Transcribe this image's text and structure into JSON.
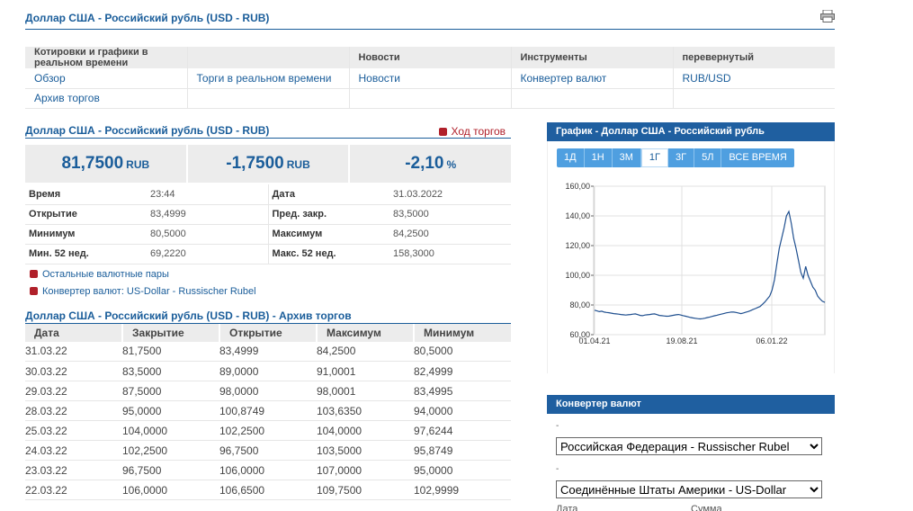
{
  "page_title": "Доллар США - Российский рубль (USD - RUB)",
  "nav": {
    "headers": [
      "Котировки и графики в реальном времени",
      "",
      "Новости",
      "Инструменты",
      "перевернутый"
    ],
    "row1": [
      "Обзор",
      "Торги в реальном времени",
      "Новости",
      "Конвертер валют",
      "RUB/USD"
    ],
    "row2": [
      "Архив торгов",
      "",
      "",
      "",
      ""
    ]
  },
  "quote": {
    "title": "Доллар США - Российский рубль (USD - RUB)",
    "live_link": "Ход торгов",
    "price": "81,7500",
    "price_unit": "RUB",
    "change": "-1,7500",
    "change_unit": "RUB",
    "change_pct": "-2,10",
    "pct_unit": "%"
  },
  "stats": [
    {
      "l1": "Время",
      "v1": "23:44",
      "l2": "Дата",
      "v2": "31.03.2022"
    },
    {
      "l1": "Открытие",
      "v1": "83,4999",
      "l2": "Пред. закр.",
      "v2": "83,5000"
    },
    {
      "l1": "Минимум",
      "v1": "80,5000",
      "l2": "Максимум",
      "v2": "84,2500"
    },
    {
      "l1": "Мин. 52 нед.",
      "v1": "69,2220",
      "l2": "Макс. 52 нед.",
      "v2": "158,3000"
    }
  ],
  "links": [
    "Остальные валютные пары",
    "Конвертер валют: US-Dollar - Russischer Rubel"
  ],
  "archive": {
    "title": "Доллар США - Российский рубль (USD - RUB) - Архив торгов",
    "headers": [
      "Дата",
      "Закрытие",
      "Открытие",
      "Максимум",
      "Минимум"
    ],
    "rows": [
      [
        "31.03.22",
        "81,7500",
        "83,4999",
        "84,2500",
        "80,5000"
      ],
      [
        "30.03.22",
        "83,5000",
        "89,0000",
        "91,0001",
        "82,4999"
      ],
      [
        "29.03.22",
        "87,5000",
        "98,0000",
        "98,0001",
        "83,4995"
      ],
      [
        "28.03.22",
        "95,0000",
        "100,8749",
        "103,6350",
        "94,0000"
      ],
      [
        "25.03.22",
        "104,0000",
        "102,2500",
        "104,0000",
        "97,6244"
      ],
      [
        "24.03.22",
        "102,2500",
        "96,7500",
        "103,5000",
        "95,8749"
      ],
      [
        "23.03.22",
        "96,7500",
        "106,0000",
        "107,0000",
        "95,0000"
      ],
      [
        "22.03.22",
        "106,0000",
        "106,6500",
        "109,7500",
        "102,9999"
      ]
    ]
  },
  "chart_panel": {
    "title": "График - Доллар США - Российский рубль",
    "timeframes": [
      "1Д",
      "1Н",
      "3М",
      "1Г",
      "3Г",
      "5Л",
      "ВСЕ ВРЕМЯ"
    ],
    "active_timeframe": "1Г"
  },
  "chart_data": {
    "type": "line",
    "x_tick_labels": [
      "01.04.21",
      "19.08.21",
      "06.01.22"
    ],
    "y_tick_labels": [
      "60,00",
      "80,00",
      "100,00",
      "120,00",
      "140,00",
      "160,00"
    ],
    "ylim": [
      60,
      160
    ],
    "grid": true,
    "line_color": "#1f4f8f",
    "series": [
      {
        "values": [
          76.5,
          76,
          75.5,
          75.8,
          75.2,
          75,
          74.8,
          74.5,
          74.2,
          74,
          73.8,
          73.6,
          73.4,
          73.2,
          73.4,
          73.6,
          73.8,
          74,
          73.5,
          73,
          72.8,
          73.2,
          73.4,
          73.6,
          73.9,
          74,
          73.5,
          73,
          72.8,
          72.6,
          72.4,
          72.5,
          72.8,
          73.1,
          73.4,
          73.6,
          73.2,
          72.8,
          72.4,
          72,
          71.6,
          71.3,
          71,
          70.8,
          70.6,
          70.8,
          71.1,
          71.5,
          71.9,
          72.3,
          72.7,
          73.1,
          73.5,
          73.9,
          74.3,
          74.7,
          75,
          75.3,
          75.2,
          75,
          74.6,
          74.2,
          74.6,
          75.1,
          75.6,
          76.2,
          76.9,
          77.6,
          78.3,
          79,
          80.5,
          82,
          84,
          86,
          90,
          97,
          108,
          118,
          125,
          132,
          140,
          143,
          135,
          125,
          118,
          110,
          102,
          98,
          106,
          100,
          96,
          92,
          90,
          86,
          84,
          82.5,
          81.75
        ]
      }
    ]
  },
  "converter": {
    "title": "Конвертер валют",
    "dash": "-",
    "from": "Российская Федерация - Russischer Rubel",
    "to": "Соединённые Штаты Америки - US-Dollar",
    "label_date": "Дата",
    "label_sum": "Сумма"
  }
}
